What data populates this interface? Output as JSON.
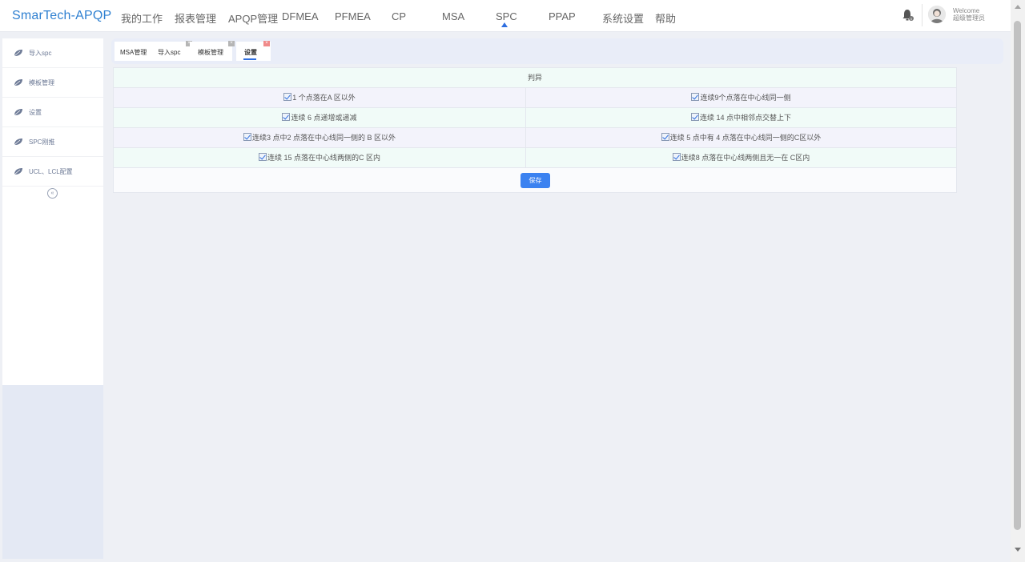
{
  "app": {
    "title": "SmarTech-APQP"
  },
  "nav": {
    "items": [
      {
        "label": "我的工作"
      },
      {
        "label": "报表管理"
      },
      {
        "label": "APQP管理"
      },
      {
        "label": "DFMEA"
      },
      {
        "label": "PFMEA"
      },
      {
        "label": "CP"
      },
      {
        "label": "MSA"
      },
      {
        "label": "SPC"
      },
      {
        "label": "PPAP"
      },
      {
        "label": "系统设置"
      },
      {
        "label": "帮助"
      }
    ],
    "active": "SPC"
  },
  "user": {
    "welcome": "Welcome",
    "role": "超级管理员"
  },
  "sidebar": {
    "items": [
      {
        "label": "导入spc"
      },
      {
        "label": "模板管理"
      },
      {
        "label": "设置"
      },
      {
        "label": "SPC刚推"
      },
      {
        "label": "UCL、LCL配置"
      }
    ],
    "collapse_glyph": "«"
  },
  "tabs": [
    {
      "label": "MSA管理"
    },
    {
      "label": "导入spc"
    },
    {
      "label": "模板管理"
    },
    {
      "label": "设置"
    }
  ],
  "tab_close_glyph": "×",
  "panel": {
    "header": "判异",
    "rules": [
      {
        "left": "1 个点落在A 区以外",
        "right": "连续9个点落在中心线同一侧"
      },
      {
        "left": "连续 6 点递增或递减",
        "right": "连续 14 点中相邻点交替上下"
      },
      {
        "left": "连续3 点中2 点落在中心线同一侧的 B 区以外",
        "right": "连续 5 点中有 4 点落在中心线同一侧的C区以外"
      },
      {
        "left": "连续 15 点落在中心线两侧的C 区内",
        "right": "连续8 点落在中心线两侧且无一在 C区内"
      }
    ],
    "save_label": "保存"
  },
  "colors": {
    "brand": "#2f80d1",
    "accent": "#3b82f0",
    "row_green": "#f1fbf8",
    "row_lavender": "#f3f3fb"
  }
}
